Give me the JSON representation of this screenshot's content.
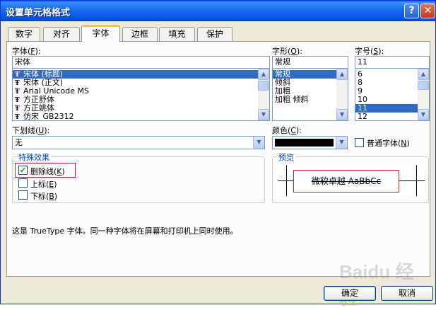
{
  "window": {
    "title": "设置单元格格式",
    "help": "?",
    "close": "✕"
  },
  "tabs": [
    {
      "label": "数字"
    },
    {
      "label": "对齐"
    },
    {
      "label": "字体"
    },
    {
      "label": "边框"
    },
    {
      "label": "填充"
    },
    {
      "label": "保护"
    }
  ],
  "font": {
    "label": "字体",
    "accel": "F",
    "value": "宋体",
    "icon": "truetype-icon",
    "items": [
      "宋体 (标题)",
      "宋体 (正文)",
      "Arial Unicode MS",
      "方正舒体",
      "方正姚体",
      "仿宋_GB2312"
    ],
    "selected_index": 0
  },
  "style": {
    "label": "字形",
    "accel": "O",
    "value": "常规",
    "items": [
      "常规",
      "倾斜",
      "加粗",
      "加粗 倾斜"
    ],
    "selected_index": 0
  },
  "size": {
    "label": "字号",
    "accel": "S",
    "value": "11",
    "items": [
      "6",
      "8",
      "9",
      "10",
      "11",
      "12"
    ],
    "selected_index": 4
  },
  "underline": {
    "label": "下划线",
    "accel": "U",
    "value": "无"
  },
  "color": {
    "label": "颜色",
    "accel": "C",
    "swatch": "#000000"
  },
  "normal_font": {
    "label": "普通字体",
    "accel": "N",
    "checked": false
  },
  "effects": {
    "title": "特殊效果",
    "strikethrough": {
      "label": "删除线",
      "accel": "K",
      "checked": true
    },
    "superscript": {
      "label": "上标",
      "accel": "E",
      "checked": false
    },
    "subscript": {
      "label": "下标",
      "accel": "B",
      "checked": false
    }
  },
  "preview": {
    "title": "预览",
    "text": "微软卓越 AaBbCc"
  },
  "info": "这是 TrueType 字体。同一种字体将在屏幕和打印机上同时使用。",
  "buttons": {
    "ok": "确定",
    "cancel": "取消"
  },
  "watermark": "Baidu 经验",
  "colors": {
    "accent": "#316ac5",
    "highlight": "#d42020",
    "tab_hot": "#ffc83c",
    "title_bar": "#0553e0"
  }
}
